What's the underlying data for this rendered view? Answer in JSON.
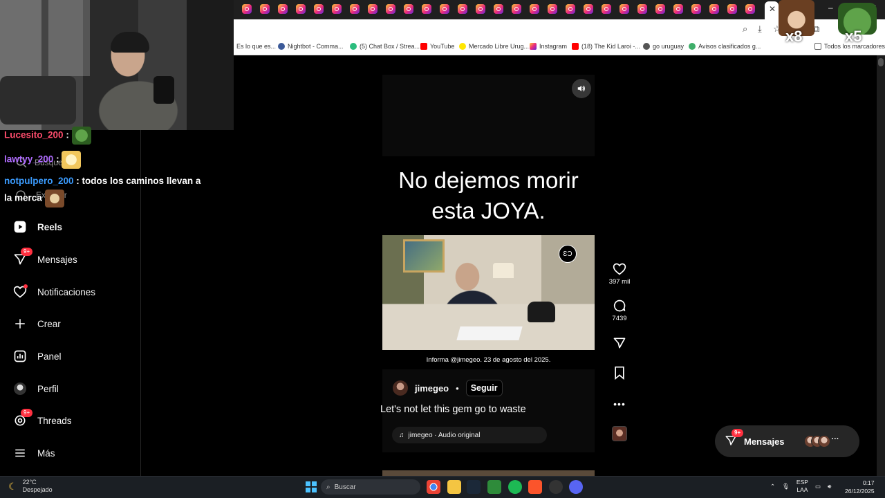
{
  "browser": {
    "tab_count_visible": 30,
    "window_controls": [
      "–",
      "▢",
      "✕"
    ]
  },
  "bookmarks": [
    {
      "label": "Es lo que es...",
      "icon": "folder-icon"
    },
    {
      "label": "Nightbot - Comma...",
      "icon": "nightbot-icon",
      "color": "#3c5a99"
    },
    {
      "label": "(5) Chat Box / Strea...",
      "icon": "chatbox-icon",
      "color": "#2bbd7e"
    },
    {
      "label": "YouTube",
      "icon": "youtube-icon",
      "color": "#ff0000"
    },
    {
      "label": "Mercado Libre Urug...",
      "icon": "mercadolibre-icon",
      "color": "#ffe600"
    },
    {
      "label": "Instagram",
      "icon": "instagram-icon",
      "color": "#e1306c"
    },
    {
      "label": "(18) The Kid Laroi -...",
      "icon": "youtube-icon",
      "color": "#ff0000"
    },
    {
      "label": "go uruguay",
      "icon": "globe-icon",
      "color": "#555555"
    },
    {
      "label": "Avisos clasificados g...",
      "icon": "gallito-icon",
      "color": "#3fae6a"
    },
    {
      "label": "Todos los marcadores",
      "icon": "folder-icon"
    }
  ],
  "sidebar": {
    "items": [
      {
        "label": "Reels",
        "icon": "reels-icon",
        "bold": true
      },
      {
        "label": "Mensajes",
        "icon": "messages-icon",
        "badge": "9+"
      },
      {
        "label": "Notificaciones",
        "icon": "heart-icon",
        "dot": true
      },
      {
        "label": "Crear",
        "icon": "plus-icon"
      },
      {
        "label": "Panel",
        "icon": "dashboard-icon"
      },
      {
        "label": "Perfil",
        "icon": "profile-icon"
      },
      {
        "label": "Threads",
        "icon": "threads-icon",
        "badge": "9+"
      },
      {
        "label": "Más",
        "icon": "menu-icon"
      }
    ],
    "search_label": "Búsqueda",
    "explore_label": "Explorar"
  },
  "chat": [
    {
      "user": "Lucesito_200",
      "text": ":"
    },
    {
      "user": "lawtyy_200",
      "text": ":"
    },
    {
      "user": "notpulpero_200",
      "text": ": todos los caminos llevan a la merca"
    }
  ],
  "reel": {
    "overlay_title_line1": "No dejemos morir",
    "overlay_title_line2": "esta JOYA.",
    "info_text": "Informa @jimegeo. 23 de agosto del 2025.",
    "video_logo": "ƐƆ",
    "author": "jimegeo",
    "separator": "•",
    "follow_label": "Seguir",
    "subtitle": "Let's not let this gem go to waste",
    "audio_label": "jimegeo · Audio original"
  },
  "actions": {
    "likes": "397 mil",
    "comments": "7439"
  },
  "messages_pill": {
    "label": "Mensajes",
    "badge": "9+",
    "more": "···"
  },
  "overlay_emotes": {
    "monkey_count": "x8",
    "pepe_count": "x5"
  },
  "taskbar": {
    "temperature": "22°C",
    "weather": "Despejado",
    "search_placeholder": "Buscar",
    "language": "ESP",
    "layout": "LAA",
    "time": "0:17",
    "date": "26/12/2025"
  },
  "colors": {
    "instagram_red": "#ff3040",
    "background": "#000000"
  }
}
